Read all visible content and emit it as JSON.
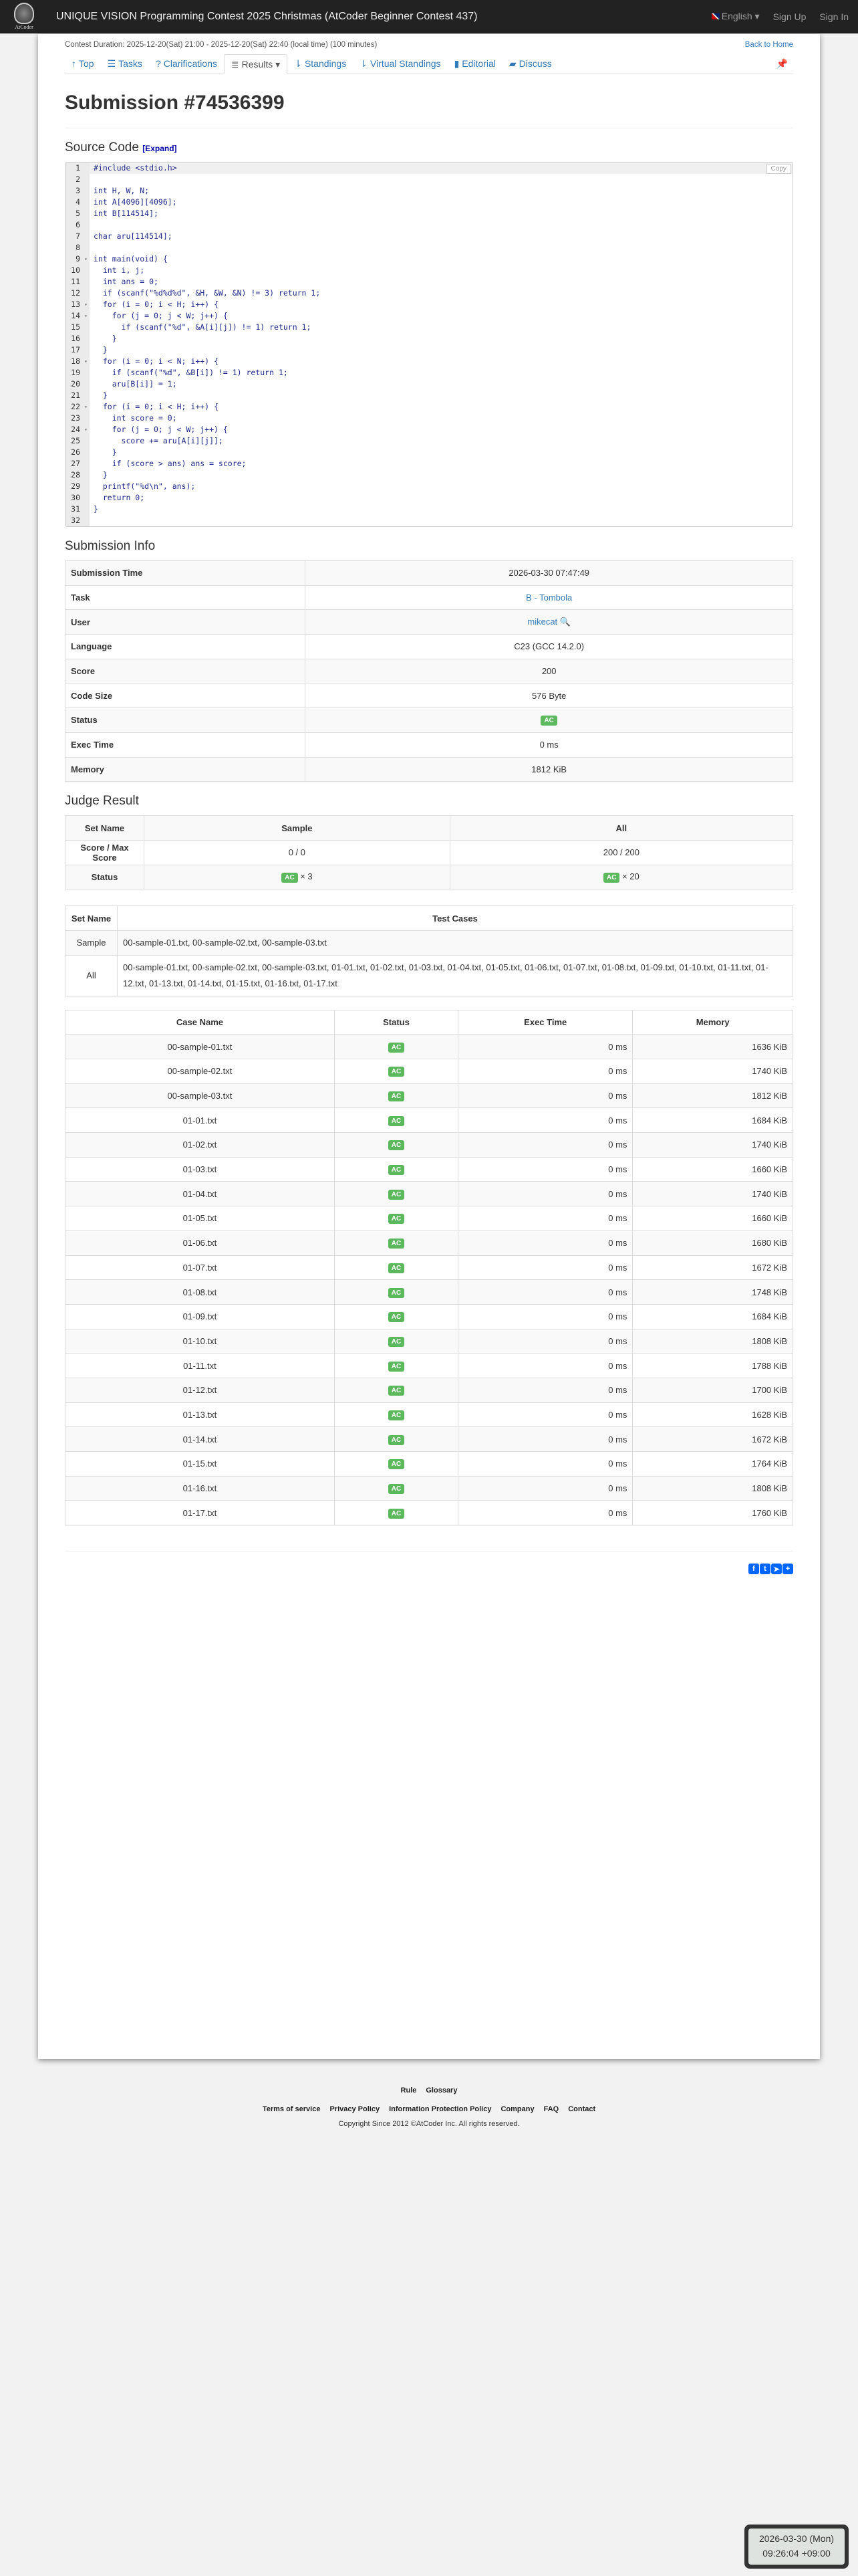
{
  "header": {
    "logo_text": "AtCoder",
    "title": "UNIQUE VISION Programming Contest 2025 Christmas (AtCoder Beginner Contest 437)",
    "language": "English",
    "sign_up": "Sign Up",
    "sign_in": "Sign In"
  },
  "contest": {
    "duration": "Contest Duration: 2025-12-20(Sat) 21:00 - 2025-12-20(Sat) 22:40 (local time) (100 minutes)",
    "back_home": "Back to Home"
  },
  "tabs": [
    {
      "label": "Top",
      "icon": "↑"
    },
    {
      "label": "Tasks",
      "icon": "☰"
    },
    {
      "label": "Clarifications",
      "icon": "?"
    },
    {
      "label": "Results ▾",
      "icon": "≣"
    },
    {
      "label": "Standings",
      "icon": "⇂"
    },
    {
      "label": "Virtual Standings",
      "icon": "⇂"
    },
    {
      "label": "Editorial",
      "icon": "▮"
    },
    {
      "label": "Discuss",
      "icon": "▰"
    }
  ],
  "page_title": "Submission #74536399",
  "source": {
    "heading": "Source Code",
    "expand": "[Expand]",
    "copy": "Copy",
    "lines": [
      "#include <stdio.h>",
      "",
      "int H, W, N;",
      "int A[4096][4096];",
      "int B[114514];",
      "",
      "char aru[114514];",
      "",
      "int main(void) {",
      "  int i, j;",
      "  int ans = 0;",
      "  if (scanf(\"%d%d%d\", &H, &W, &N) != 3) return 1;",
      "  for (i = 0; i < H; i++) {",
      "    for (j = 0; j < W; j++) {",
      "      if (scanf(\"%d\", &A[i][j]) != 1) return 1;",
      "    }",
      "  }",
      "  for (i = 0; i < N; i++) {",
      "    if (scanf(\"%d\", &B[i]) != 1) return 1;",
      "    aru[B[i]] = 1;",
      "  }",
      "  for (i = 0; i < H; i++) {",
      "    int score = 0;",
      "    for (j = 0; j < W; j++) {",
      "      score += aru[A[i][j]];",
      "    }",
      "    if (score > ans) ans = score;",
      "  }",
      "  printf(\"%d\\n\", ans);",
      "  return 0;",
      "}",
      ""
    ],
    "fold_lines": [
      9,
      13,
      14,
      18,
      22,
      24
    ]
  },
  "info": {
    "heading": "Submission Info",
    "rows": [
      {
        "label": "Submission Time",
        "value": "2026-03-30 07:47:49"
      },
      {
        "label": "Task",
        "value": "B - Tombola",
        "link": true
      },
      {
        "label": "User",
        "value": "mikecat",
        "link": true,
        "search": true
      },
      {
        "label": "Language",
        "value": "C23 (GCC 14.2.0)"
      },
      {
        "label": "Score",
        "value": "200"
      },
      {
        "label": "Code Size",
        "value": "576 Byte"
      },
      {
        "label": "Status",
        "value": "AC",
        "badge": true
      },
      {
        "label": "Exec Time",
        "value": "0 ms"
      },
      {
        "label": "Memory",
        "value": "1812 KiB"
      }
    ]
  },
  "judge": {
    "heading": "Judge Result",
    "summary": {
      "headers": [
        "Set Name",
        "Sample",
        "All"
      ],
      "score_label": "Score / Max Score",
      "scores": [
        "0 / 0",
        "200 / 200"
      ],
      "status_label": "Status",
      "statuses": [
        {
          "badge": "AC",
          "count": "× 3"
        },
        {
          "badge": "AC",
          "count": "× 20"
        }
      ]
    },
    "sets": {
      "headers": [
        "Set Name",
        "Test Cases"
      ],
      "rows": [
        {
          "name": "Sample",
          "cases": "00-sample-01.txt, 00-sample-02.txt, 00-sample-03.txt"
        },
        {
          "name": "All",
          "cases": "00-sample-01.txt, 00-sample-02.txt, 00-sample-03.txt, 01-01.txt, 01-02.txt, 01-03.txt, 01-04.txt, 01-05.txt, 01-06.txt, 01-07.txt, 01-08.txt, 01-09.txt, 01-10.txt, 01-11.txt, 01-12.txt, 01-13.txt, 01-14.txt, 01-15.txt, 01-16.txt, 01-17.txt"
        }
      ]
    },
    "cases": {
      "headers": [
        "Case Name",
        "Status",
        "Exec Time",
        "Memory"
      ],
      "rows": [
        [
          "00-sample-01.txt",
          "AC",
          "0 ms",
          "1636 KiB"
        ],
        [
          "00-sample-02.txt",
          "AC",
          "0 ms",
          "1740 KiB"
        ],
        [
          "00-sample-03.txt",
          "AC",
          "0 ms",
          "1812 KiB"
        ],
        [
          "01-01.txt",
          "AC",
          "0 ms",
          "1684 KiB"
        ],
        [
          "01-02.txt",
          "AC",
          "0 ms",
          "1740 KiB"
        ],
        [
          "01-03.txt",
          "AC",
          "0 ms",
          "1660 KiB"
        ],
        [
          "01-04.txt",
          "AC",
          "0 ms",
          "1740 KiB"
        ],
        [
          "01-05.txt",
          "AC",
          "0 ms",
          "1660 KiB"
        ],
        [
          "01-06.txt",
          "AC",
          "0 ms",
          "1680 KiB"
        ],
        [
          "01-07.txt",
          "AC",
          "0 ms",
          "1672 KiB"
        ],
        [
          "01-08.txt",
          "AC",
          "0 ms",
          "1748 KiB"
        ],
        [
          "01-09.txt",
          "AC",
          "0 ms",
          "1684 KiB"
        ],
        [
          "01-10.txt",
          "AC",
          "0 ms",
          "1808 KiB"
        ],
        [
          "01-11.txt",
          "AC",
          "0 ms",
          "1788 KiB"
        ],
        [
          "01-12.txt",
          "AC",
          "0 ms",
          "1700 KiB"
        ],
        [
          "01-13.txt",
          "AC",
          "0 ms",
          "1628 KiB"
        ],
        [
          "01-14.txt",
          "AC",
          "0 ms",
          "1672 KiB"
        ],
        [
          "01-15.txt",
          "AC",
          "0 ms",
          "1764 KiB"
        ],
        [
          "01-16.txt",
          "AC",
          "0 ms",
          "1808 KiB"
        ],
        [
          "01-17.txt",
          "AC",
          "0 ms",
          "1760 KiB"
        ]
      ]
    }
  },
  "share": [
    {
      "name": "facebook",
      "glyph": "f"
    },
    {
      "name": "twitter",
      "glyph": "t"
    },
    {
      "name": "telegram",
      "glyph": "➤"
    },
    {
      "name": "share",
      "glyph": "+"
    }
  ],
  "footer": {
    "row1": [
      "Rule",
      "Glossary"
    ],
    "row2": [
      "Terms of service",
      "Privacy Policy",
      "Information Protection Policy",
      "Company",
      "FAQ",
      "Contact"
    ],
    "copyright": "Copyright Since 2012 ©AtCoder Inc. All rights reserved."
  },
  "clock": {
    "date": "2026-03-30 (Mon)",
    "time": "09:26:04 +09:00"
  },
  "colors": {
    "ac": "#5cb85c",
    "link": "#337ab7",
    "navbar": "#222222"
  }
}
